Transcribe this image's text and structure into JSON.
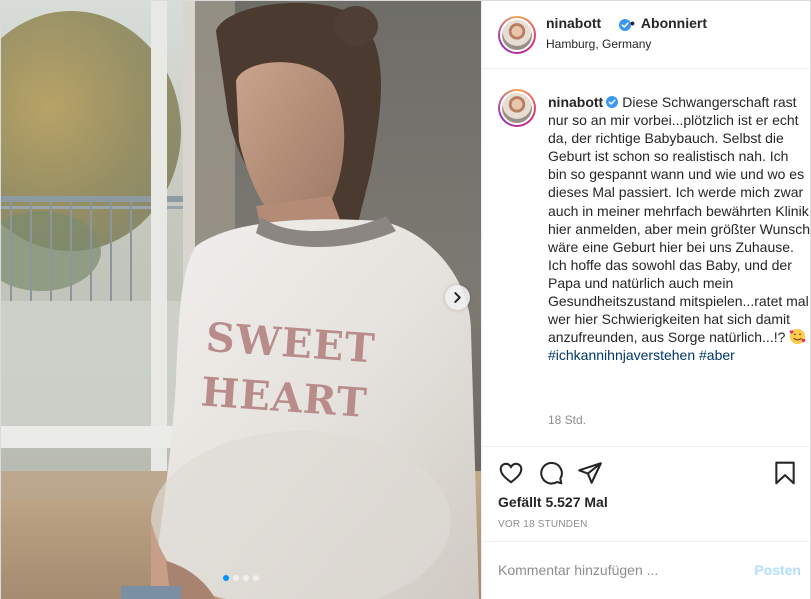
{
  "header": {
    "username": "ninabott",
    "follow_state": "Abonniert",
    "location": "Hamburg, Germany"
  },
  "media": {
    "shirt_text": [
      "SWEET",
      "HEART"
    ],
    "carousel_dots": 4,
    "active_dot": 1
  },
  "caption": {
    "username": "ninabott",
    "text": "Diese Schwangerschaft rast nur so an mir vorbei...plötzlich ist er echt da, der richtige Babybauch. Selbst die Geburt ist schon so realistisch nah. Ich bin so gespannt wann und wie und wo es dieses Mal passiert. Ich werde mich zwar auch in meiner mehrfach bewährten Klinik hier anmelden, aber mein größter Wunsch wäre eine Geburt hier bei uns Zuhause. Ich hoffe das sowohl das Baby, und der Papa und natürlich auch mein Gesundheitszustand mitspielen...ratet mal wer hier Schwierigkeiten hat sich damit anzufreunden, aus Sorge natürlich...!? ",
    "hashtags": [
      "#ichkannihnjaverstehen",
      "#aber"
    ],
    "time_ago": "18 Std."
  },
  "stats": {
    "likes_label": "Gefällt 5.527 Mal",
    "post_date": "VOR 18 STUNDEN"
  },
  "comment": {
    "placeholder": "Kommentar hinzufügen ...",
    "post_label": "Posten"
  },
  "colors": {
    "verified": "#3897f0",
    "hashtag": "#00376b",
    "post_button_disabled": "#b2dffc",
    "shirt_print": "#b98c8c"
  },
  "icons": [
    "verified-badge-icon",
    "chevron-right-icon",
    "heart-icon",
    "comment-icon",
    "share-icon",
    "bookmark-icon",
    "smiling-face-with-hearts-emoji"
  ]
}
